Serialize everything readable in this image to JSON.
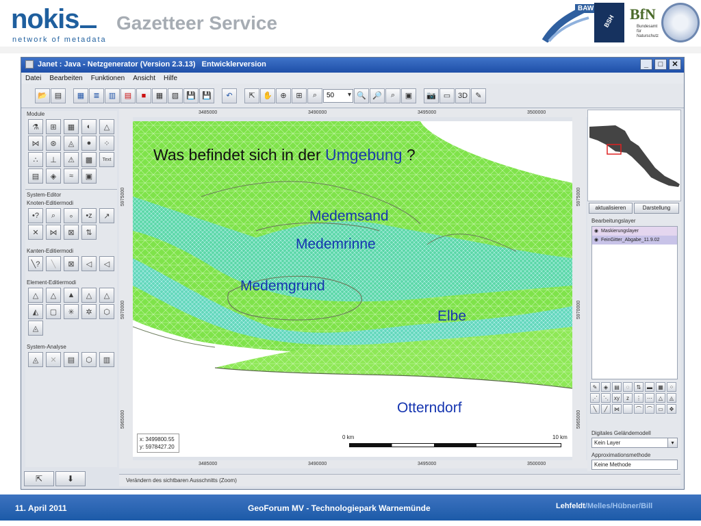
{
  "slide": {
    "logo_word": "nokis",
    "logo_tagline": "network of metadata",
    "title": "Gazetteer Service",
    "partner_logos": {
      "baw": "BAW",
      "bsh": "BSH",
      "bfn": "BfN",
      "bfn_sub": "Bundesamt für Naturschutz"
    },
    "footer": {
      "date": "11. April 2011",
      "event": "GeoForum MV - Technologiepark Warnemünde",
      "author_main": "Lehfeldt",
      "author_rest": "/Melles/Hübner/Bill"
    }
  },
  "window": {
    "title": "Janet : Java - Netzgenerator (Version 2.3.13)",
    "title_suffix": "Entwicklerversion",
    "controls": [
      "_",
      "□",
      "✕"
    ],
    "menu": [
      "Datei",
      "Bearbeiten",
      "Funktionen",
      "Ansicht",
      "Hilfe"
    ],
    "toolbar": {
      "zoom_value": "50"
    },
    "left_panel": {
      "module_label": "Module",
      "system_editor_label": "System-Editor",
      "knoten_label": "Knoten-Editiermodi",
      "kanten_label": "Kanten-Editiermodi",
      "element_label": "Element-Editiermodi",
      "analyse_label": "System-Analyse",
      "text_button": "Text"
    },
    "rulers": {
      "top": [
        "3485000",
        "3490000",
        "3495000",
        "3500000"
      ],
      "bottom": [
        "3485000",
        "3490000",
        "3495000",
        "3500000"
      ],
      "left": [
        "5975000",
        "5970000",
        "5965000"
      ],
      "right": [
        "5975000",
        "5970000",
        "5965000"
      ]
    },
    "map": {
      "question_start": "Was befindet sich in der ",
      "question_highlight": "Umgebung",
      "question_end": " ?",
      "places": {
        "medemsand": "Medemsand",
        "medemrinne": "Medemrinne",
        "medemgrund": "Medemgrund",
        "elbe": "Elbe",
        "otterndorf": "Otterndorf"
      },
      "coord_x": "x: 3499800.55",
      "coord_y": "y: 5978427.20",
      "scale_start": "0 km",
      "scale_end": "10 km"
    },
    "right_panel": {
      "btn_refresh": "aktualisieren",
      "btn_display": "Darstellung",
      "layer_title": "Bearbeitungslayer",
      "layers": [
        "Maskierungslayer",
        "FeinGitter_Abgabe_11.9.02"
      ],
      "dgm_label": "Digitales Geländemodell",
      "dgm_value": "Kein Layer",
      "approx_label": "Approximationsmethode",
      "approx_value": "Keine Methode"
    },
    "status_text": "Verändern des sichtbaren Ausschnitts (Zoom)"
  },
  "colors": {
    "brand_blue": "#1f5f9e",
    "footer_blue": "#1c5aa8",
    "mesh_green": "#7fe34a",
    "channel_cyan": "#57d6b8",
    "label_blue": "#1535b0"
  }
}
